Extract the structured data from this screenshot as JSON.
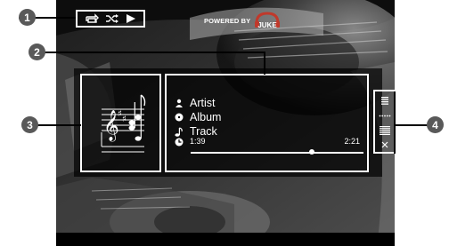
{
  "callouts": [
    "1",
    "2",
    "3",
    "4"
  ],
  "toolbar": {
    "icons": [
      "repeat-icon",
      "shuffle-icon",
      "play-icon"
    ]
  },
  "branding": {
    "powered_by": "POWERED BY",
    "brand": "JUKE"
  },
  "now_playing": {
    "artist": "Artist",
    "album": "Album",
    "track": "Track",
    "elapsed": "1:39",
    "total": "2:21",
    "progress_fraction": 0.7,
    "icons": [
      "artist-icon",
      "album-icon",
      "track-icon",
      "clock-icon"
    ]
  },
  "side_menu": {
    "items": [
      {
        "icon": "list-icon",
        "label": "≡"
      },
      {
        "icon": "dots-icon",
        "label": "·····"
      },
      {
        "icon": "detail-list-icon",
        "label": "≣"
      },
      {
        "icon": "close-icon",
        "label": "×"
      }
    ]
  },
  "colors": {
    "callout_bg": "#595959",
    "frame": "#ffffff",
    "screen_bg": "#000000",
    "brand_accent": "#c0392b"
  }
}
